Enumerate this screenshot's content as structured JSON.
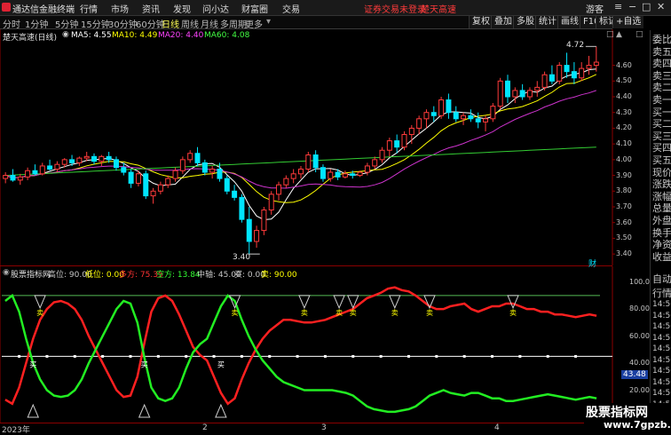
{
  "app": {
    "title": "通达信金融终端",
    "menu": [
      "行情",
      "市场",
      "资讯",
      "发现",
      "问小达",
      "财富圈",
      "交易"
    ],
    "login_notice": "证券交易未登录",
    "stock_link": "楚天高速",
    "guest": "游客"
  },
  "period_tabs": [
    "分时",
    "1分钟",
    "5分钟",
    "15分钟",
    "30分钟",
    "60分钟",
    "日线",
    "周线",
    "月线",
    "多周期",
    "更多"
  ],
  "active_tab": "日线",
  "tools": [
    "复权",
    "叠加",
    "多股",
    "统计",
    "画线",
    "F10",
    "标记",
    "+自选"
  ],
  "main_header": {
    "name": "楚天高速(日线)",
    "ma": [
      {
        "label": "MA5: 4.55",
        "color": "#ffffff"
      },
      {
        "label": "MA10: 4.49",
        "color": "#ffff00"
      },
      {
        "label": "MA20: 4.40",
        "color": "#ff44ff"
      },
      {
        "label": "MA60: 4.08",
        "color": "#44ff44"
      }
    ]
  },
  "price_axis": [
    "4.60",
    "4.50",
    "4.40",
    "4.30",
    "4.20",
    "4.10",
    "4.00",
    "3.90",
    "3.80",
    "3.70",
    "3.60",
    "3.50",
    "3.40"
  ],
  "price_annotations": {
    "high": "4.72",
    "low": "3.40"
  },
  "fin_badge": "财",
  "indicator_header": {
    "name": "股票指标网",
    "items": [
      {
        "label": "高位: 90.00",
        "color": "#c8c8c8"
      },
      {
        "label": "低位: 0.00",
        "color": "#ffff00"
      },
      {
        "label": "多方: 75.35",
        "color": "#ff3333"
      },
      {
        "label": "空方: 13.84",
        "color": "#33ff33"
      },
      {
        "label": "中轴: 45.00",
        "color": "#c8c8c8"
      },
      {
        "label": "买: 0.00",
        "color": "#c8c8c8"
      },
      {
        "label": "卖: 90.00",
        "color": "#ffff00"
      }
    ]
  },
  "indicator_axis": [
    "100.0",
    "80.00",
    "60.00",
    "40.00",
    "20.00"
  ],
  "indicator_current": "43.48",
  "signal_labels": {
    "buy": "买",
    "sell": "卖"
  },
  "x_axis": [
    "2023年",
    "2",
    "3",
    "4"
  ],
  "right_panel": {
    "top": [
      "委比",
      "卖五",
      "卖四",
      "卖三",
      "卖二",
      "卖一",
      "买一",
      "买二",
      "买三",
      "买四",
      "买五",
      "现价",
      "涨跌",
      "涨幅",
      "总量",
      "外盘",
      "换手",
      "净资",
      "收益"
    ],
    "bottom_title": [
      "自动",
      "行情"
    ],
    "times": [
      "14:56",
      "14:56",
      "14:56",
      "14:56",
      "14:56",
      "14:56",
      "14:56",
      "14:56",
      "14:56",
      "14:56",
      "14:56"
    ]
  },
  "watermark": {
    "line1": "股票指标网",
    "line2": "www.7gpzb.com"
  },
  "colors": {
    "up": "#ff3b3b",
    "down": "#00e5ff",
    "ma5": "#ffffff",
    "ma10": "#ffff00",
    "ma20": "#cc33cc",
    "ma60": "#33cc33",
    "bull": "#ff2020",
    "bear": "#22ee22"
  },
  "chart_data": [
    {
      "type": "candlestick",
      "title": "楚天高速(日线)",
      "ylim": [
        3.35,
        4.75
      ],
      "x": [
        0,
        1,
        2,
        3,
        4,
        5,
        6,
        7,
        8,
        9,
        10,
        11,
        12,
        13,
        14,
        15,
        16,
        17,
        18,
        19,
        20,
        21,
        22,
        23,
        24,
        25,
        26,
        27,
        28,
        29,
        30,
        31,
        32,
        33,
        34,
        35,
        36,
        37,
        38,
        39,
        40,
        41,
        42,
        43,
        44,
        45,
        46,
        47,
        48,
        49,
        50,
        51,
        52,
        53,
        54,
        55,
        56,
        57,
        58,
        59,
        60,
        61,
        62,
        63,
        64,
        65,
        66,
        67,
        68,
        69,
        70,
        71,
        72,
        73,
        74,
        75,
        76,
        77,
        78,
        79,
        80,
        81,
        82,
        83,
        84,
        85,
        86,
        87,
        88,
        89,
        90,
        91
      ],
      "ohlc": [
        [
          3.88,
          3.92,
          3.85,
          3.9
        ],
        [
          3.9,
          3.94,
          3.86,
          3.87
        ],
        [
          3.87,
          3.91,
          3.84,
          3.89
        ],
        [
          3.89,
          3.95,
          3.87,
          3.93
        ],
        [
          3.93,
          3.97,
          3.9,
          3.91
        ],
        [
          3.91,
          3.98,
          3.9,
          3.96
        ],
        [
          3.96,
          4.0,
          3.93,
          3.94
        ],
        [
          3.94,
          3.99,
          3.92,
          3.97
        ],
        [
          3.97,
          4.01,
          3.95,
          4.0
        ],
        [
          4.0,
          4.03,
          3.96,
          3.98
        ],
        [
          3.98,
          4.02,
          3.96,
          4.01
        ],
        [
          4.01,
          4.05,
          3.99,
          4.02
        ],
        [
          4.02,
          4.04,
          3.97,
          3.99
        ],
        [
          3.99,
          4.03,
          3.96,
          4.02
        ],
        [
          4.02,
          4.05,
          3.98,
          4.0
        ],
        [
          4.0,
          4.02,
          3.93,
          3.95
        ],
        [
          3.95,
          3.98,
          3.9,
          3.92
        ],
        [
          3.92,
          3.94,
          3.82,
          3.85
        ],
        [
          3.85,
          3.93,
          3.83,
          3.91
        ],
        [
          3.91,
          3.93,
          3.75,
          3.77
        ],
        [
          3.77,
          3.82,
          3.72,
          3.8
        ],
        [
          3.8,
          3.86,
          3.78,
          3.84
        ],
        [
          3.84,
          3.9,
          3.82,
          3.88
        ],
        [
          3.88,
          3.95,
          3.86,
          3.93
        ],
        [
          3.93,
          4.02,
          3.91,
          4.0
        ],
        [
          4.0,
          4.06,
          3.98,
          4.04
        ],
        [
          4.04,
          4.08,
          3.96,
          3.98
        ],
        [
          3.98,
          4.0,
          3.9,
          3.92
        ],
        [
          3.92,
          3.96,
          3.88,
          3.94
        ],
        [
          3.94,
          3.98,
          3.86,
          3.88
        ],
        [
          3.88,
          3.9,
          3.78,
          3.8
        ],
        [
          3.8,
          3.84,
          3.74,
          3.76
        ],
        [
          3.76,
          3.78,
          3.6,
          3.62
        ],
        [
          3.62,
          3.7,
          3.4,
          3.48
        ],
        [
          3.48,
          3.58,
          3.44,
          3.55
        ],
        [
          3.55,
          3.7,
          3.52,
          3.68
        ],
        [
          3.68,
          3.8,
          3.65,
          3.78
        ],
        [
          3.78,
          3.86,
          3.74,
          3.84
        ],
        [
          3.84,
          3.9,
          3.82,
          3.88
        ],
        [
          3.88,
          3.94,
          3.85,
          3.91
        ],
        [
          3.91,
          3.96,
          3.88,
          3.94
        ],
        [
          3.94,
          4.05,
          3.92,
          4.03
        ],
        [
          4.03,
          4.06,
          3.92,
          3.95
        ],
        [
          3.95,
          3.97,
          3.86,
          3.88
        ],
        [
          3.88,
          3.94,
          3.86,
          3.92
        ],
        [
          3.92,
          3.94,
          3.87,
          3.89
        ],
        [
          3.89,
          3.93,
          3.88,
          3.91
        ],
        [
          3.91,
          3.93,
          3.88,
          3.9
        ],
        [
          3.9,
          3.93,
          3.89,
          3.92
        ],
        [
          3.92,
          3.98,
          3.9,
          3.96
        ],
        [
          3.96,
          4.02,
          3.94,
          4.0
        ],
        [
          4.0,
          4.08,
          3.98,
          4.06
        ],
        [
          4.06,
          4.14,
          4.02,
          4.12
        ],
        [
          4.12,
          4.16,
          4.04,
          4.08
        ],
        [
          4.08,
          4.18,
          4.06,
          4.16
        ],
        [
          4.16,
          4.22,
          4.1,
          4.2
        ],
        [
          4.2,
          4.28,
          4.16,
          4.26
        ],
        [
          4.26,
          4.32,
          4.2,
          4.3
        ],
        [
          4.3,
          4.34,
          4.24,
          4.28
        ],
        [
          4.28,
          4.4,
          4.26,
          4.38
        ],
        [
          4.38,
          4.42,
          4.26,
          4.3
        ],
        [
          4.3,
          4.34,
          4.24,
          4.26
        ],
        [
          4.26,
          4.3,
          4.22,
          4.28
        ],
        [
          4.28,
          4.32,
          4.24,
          4.26
        ],
        [
          4.26,
          4.3,
          4.2,
          4.24
        ],
        [
          4.24,
          4.28,
          4.18,
          4.26
        ],
        [
          4.26,
          4.36,
          4.24,
          4.34
        ],
        [
          4.34,
          4.52,
          4.32,
          4.5
        ],
        [
          4.5,
          4.54,
          4.36,
          4.4
        ],
        [
          4.4,
          4.46,
          4.36,
          4.44
        ],
        [
          4.44,
          4.48,
          4.38,
          4.4
        ],
        [
          4.4,
          4.46,
          4.38,
          4.44
        ],
        [
          4.44,
          4.5,
          4.4,
          4.46
        ],
        [
          4.46,
          4.56,
          4.44,
          4.54
        ],
        [
          4.54,
          4.6,
          4.48,
          4.5
        ],
        [
          4.5,
          4.62,
          4.48,
          4.6
        ],
        [
          4.6,
          4.68,
          4.52,
          4.56
        ],
        [
          4.56,
          4.62,
          4.48,
          4.52
        ],
        [
          4.52,
          4.62,
          4.5,
          4.58
        ],
        [
          4.58,
          4.66,
          4.54,
          4.6
        ],
        [
          4.6,
          4.72,
          4.56,
          4.62
        ]
      ],
      "ma_series": [
        {
          "name": "MA5",
          "color": "#ffffff"
        },
        {
          "name": "MA10",
          "color": "#ffff00"
        },
        {
          "name": "MA20",
          "color": "#cc33cc"
        },
        {
          "name": "MA60",
          "color": "#33cc33"
        }
      ]
    },
    {
      "type": "line",
      "title": "股票指标网",
      "ylim": [
        0,
        105
      ],
      "series": [
        {
          "name": "多方",
          "color": "#ff2020",
          "values": [
            13,
            10,
            22,
            40,
            58,
            72,
            80,
            85,
            86,
            84,
            80,
            72,
            60,
            50,
            40,
            30,
            20,
            15,
            16,
            30,
            55,
            78,
            88,
            90,
            86,
            76,
            64,
            52,
            46,
            42,
            30,
            18,
            10,
            14,
            28,
            40,
            50,
            58,
            64,
            68,
            72,
            72,
            71,
            70,
            70,
            71,
            72,
            74,
            76,
            78,
            80,
            84,
            88,
            90,
            92,
            95,
            96,
            94,
            93,
            90,
            86,
            82,
            80,
            80,
            82,
            83,
            84,
            80,
            78,
            80,
            82,
            82,
            84,
            84,
            82,
            80,
            80,
            78,
            78,
            76,
            76,
            75,
            74,
            75,
            76,
            75
          ]
        },
        {
          "name": "空方",
          "color": "#22ee22",
          "values": [
            86,
            90,
            78,
            58,
            40,
            28,
            20,
            16,
            15,
            16,
            20,
            28,
            40,
            50,
            60,
            70,
            80,
            86,
            84,
            70,
            44,
            22,
            14,
            12,
            14,
            22,
            36,
            48,
            54,
            58,
            70,
            82,
            90,
            86,
            72,
            60,
            50,
            42,
            36,
            30,
            26,
            24,
            22,
            20,
            20,
            20,
            20,
            20,
            19,
            18,
            16,
            12,
            8,
            6,
            5,
            4,
            4,
            5,
            6,
            8,
            12,
            16,
            18,
            20,
            18,
            17,
            16,
            18,
            18,
            16,
            14,
            14,
            12,
            12,
            13,
            14,
            15,
            16,
            17,
            16,
            15,
            14,
            13,
            14,
            15,
            14
          ]
        }
      ],
      "reference_lines": [
        {
          "label": "中轴",
          "value": 45
        },
        {
          "label": "高位",
          "value": 90
        }
      ]
    }
  ]
}
